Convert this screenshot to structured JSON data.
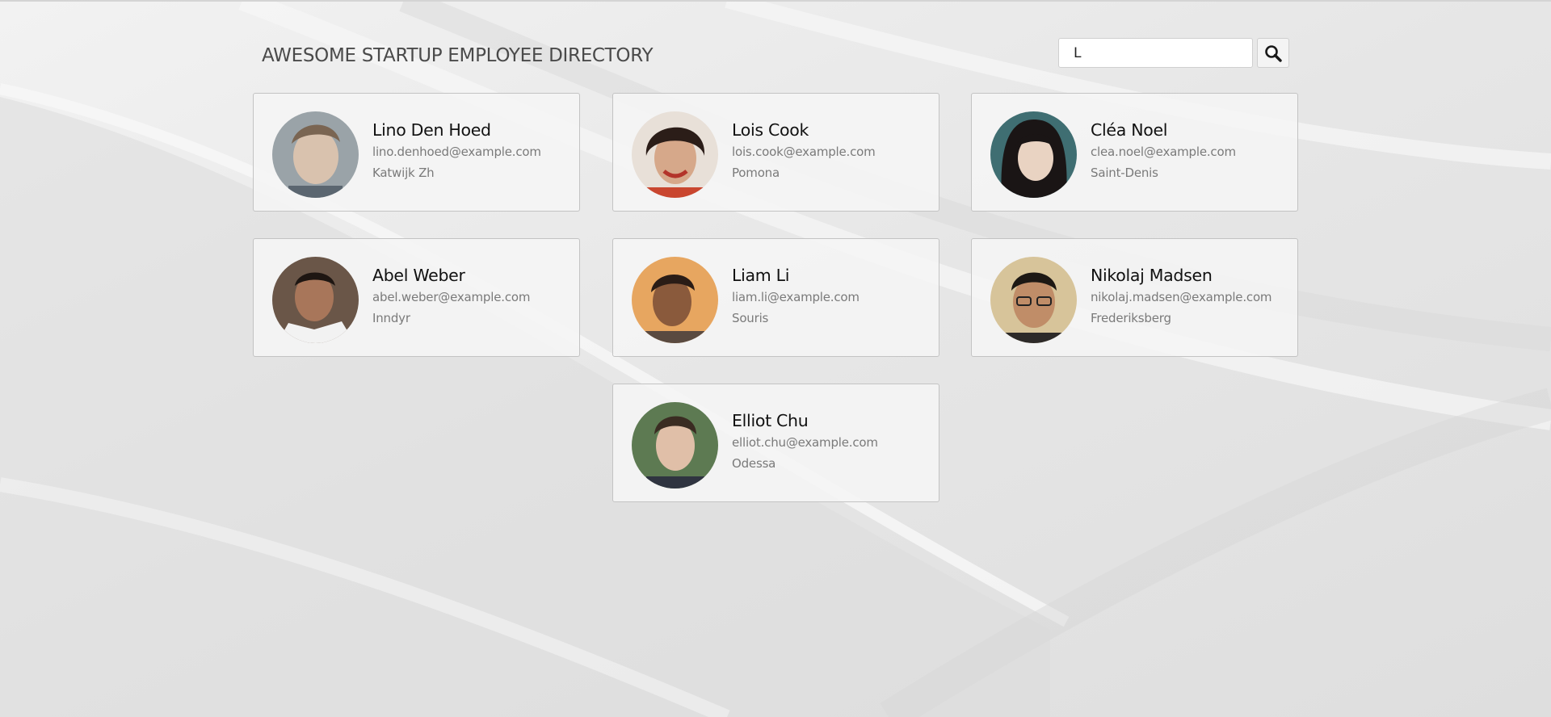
{
  "header": {
    "title": "AWESOME STARTUP EMPLOYEE DIRECTORY"
  },
  "search": {
    "value": "L",
    "button_icon": "search-icon"
  },
  "employees": [
    {
      "name": "Lino Den Hoed",
      "email": "lino.denhoed@example.com",
      "location": "Katwijk Zh",
      "avatar_colors": [
        "#9aa3a8",
        "#d9c2ae",
        "#7a6552"
      ]
    },
    {
      "name": "Lois Cook",
      "email": "lois.cook@example.com",
      "location": "Pomona",
      "avatar_colors": [
        "#e8e0d8",
        "#d6a88a",
        "#2b1d18"
      ]
    },
    {
      "name": "Cléa Noel",
      "email": "clea.noel@example.com",
      "location": "Saint-Denis",
      "avatar_colors": [
        "#3f6e72",
        "#e9d3c2",
        "#1a1515"
      ]
    },
    {
      "name": "Abel Weber",
      "email": "abel.weber@example.com",
      "location": "Inndyr",
      "avatar_colors": [
        "#6a5648",
        "#a8765a",
        "#f2f2f2"
      ]
    },
    {
      "name": "Liam Li",
      "email": "liam.li@example.com",
      "location": "Souris",
      "avatar_colors": [
        "#e7a660",
        "#8a5a3c",
        "#2a1c16"
      ]
    },
    {
      "name": "Nikolaj Madsen",
      "email": "nikolaj.madsen@example.com",
      "location": "Frederiksberg",
      "avatar_colors": [
        "#d7c49a",
        "#c08d68",
        "#1d1814"
      ]
    },
    {
      "name": "Elliot Chu",
      "email": "elliot.chu@example.com",
      "location": "Odessa",
      "avatar_colors": [
        "#5d7a52",
        "#e0bfa8",
        "#3a2c22"
      ]
    }
  ]
}
